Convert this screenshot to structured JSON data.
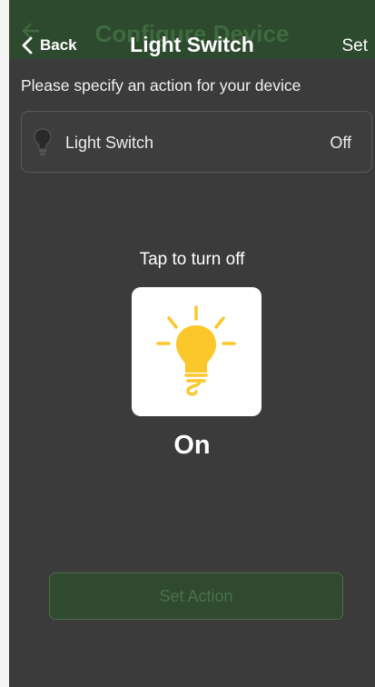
{
  "header": {
    "ghost_title": "Configure Device",
    "back_label": "Back",
    "title": "Light Switch",
    "set_label": "Set"
  },
  "instruction": "Please specify an action for your device",
  "device": {
    "name": "Light Switch",
    "state": "Off",
    "icon": "lightbulb-icon"
  },
  "toggle": {
    "hint": "Tap to turn off",
    "state_label": "On",
    "icon": "lightbulb-on-icon",
    "bulb_color": "#fcc72b"
  },
  "action_button": {
    "label": "Set Action"
  },
  "colors": {
    "header_bg": "#2e4a2e",
    "page_bg": "#3b3b3b",
    "button_bg": "#2f4a2f"
  }
}
